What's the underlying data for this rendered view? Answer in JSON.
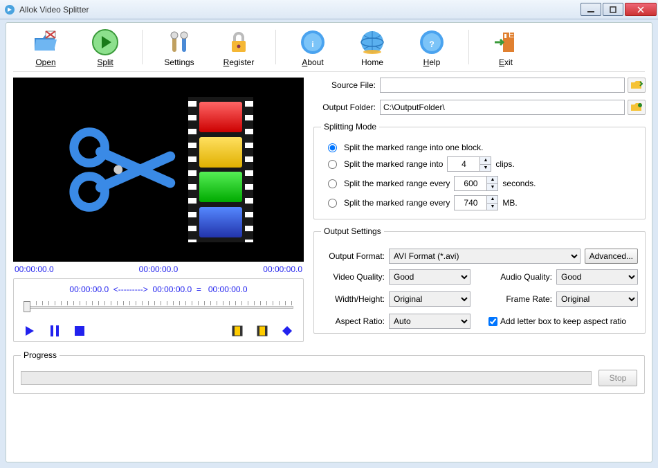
{
  "window": {
    "title": "Allok Video Splitter"
  },
  "toolbar": {
    "open": "Open",
    "split": "Split",
    "settings": "Settings",
    "register": "Register",
    "about": "About",
    "home": "Home",
    "help": "Help",
    "exit": "Exit"
  },
  "times": {
    "start": "00:00:00.0",
    "mid": "00:00:00.0",
    "end": "00:00:00.0"
  },
  "range": {
    "t1": "00:00:00.0",
    "arrow": "<--------->",
    "t2": "00:00:00.0",
    "eq": "=",
    "t3": "00:00:00.0"
  },
  "source": {
    "label": "Source File:",
    "value": ""
  },
  "output": {
    "label": "Output Folder:",
    "value": "C:\\OutputFolder\\"
  },
  "splitting": {
    "legend": "Splitting Mode",
    "opt1": "Split the marked range into one block.",
    "opt2a": "Split the marked range into",
    "opt2_val": "4",
    "opt2b": "clips.",
    "opt3a": "Split the marked range every",
    "opt3_val": "600",
    "opt3b": "seconds.",
    "opt4a": "Split the marked range every",
    "opt4_val": "740",
    "opt4b": "MB."
  },
  "outset": {
    "legend": "Output Settings",
    "format_lbl": "Output Format:",
    "format_val": "AVI Format (*.avi)",
    "advanced": "Advanced...",
    "vq_lbl": "Video Quality:",
    "vq_val": "Good",
    "aq_lbl": "Audio Quality:",
    "aq_val": "Good",
    "wh_lbl": "Width/Height:",
    "wh_val": "Original",
    "fr_lbl": "Frame Rate:",
    "fr_val": "Original",
    "ar_lbl": "Aspect Ratio:",
    "ar_val": "Auto",
    "letterbox": "Add letter box to keep aspect ratio"
  },
  "progress": {
    "legend": "Progress",
    "stop": "Stop"
  }
}
